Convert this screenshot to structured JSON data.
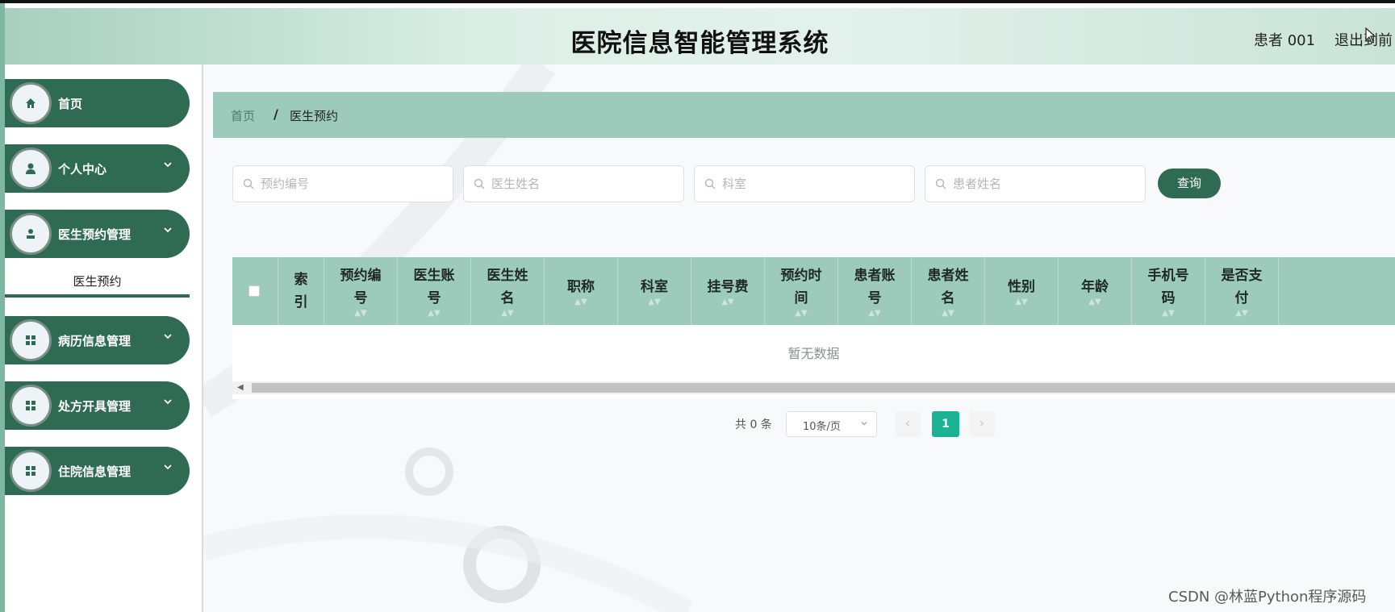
{
  "header": {
    "title": "医院信息智能管理系统",
    "user_label": "患者 001",
    "logout_label": "退出到前"
  },
  "sidebar": {
    "items": [
      {
        "label": "首页",
        "icon": "home-icon"
      },
      {
        "label": "个人中心",
        "icon": "user-icon"
      },
      {
        "label": "医生预约管理",
        "icon": "doctor-icon"
      },
      {
        "label": "病历信息管理",
        "icon": "grid-icon"
      },
      {
        "label": "处方开具管理",
        "icon": "grid-icon"
      },
      {
        "label": "住院信息管理",
        "icon": "grid-icon"
      }
    ],
    "submenu": {
      "label": "医生预约"
    }
  },
  "breadcrumb": {
    "home": "首页",
    "separator": "/",
    "current": "医生预约"
  },
  "search": {
    "fields": [
      {
        "placeholder": "预约编号"
      },
      {
        "placeholder": "医生姓名"
      },
      {
        "placeholder": "科室"
      },
      {
        "placeholder": "患者姓名"
      }
    ],
    "button_label": "查询"
  },
  "table": {
    "columns": [
      {
        "label": "索引",
        "sortable": false
      },
      {
        "label": "预约编号",
        "sortable": true
      },
      {
        "label": "医生账号",
        "sortable": true
      },
      {
        "label": "医生姓名",
        "sortable": true
      },
      {
        "label": "职称",
        "sortable": true
      },
      {
        "label": "科室",
        "sortable": true
      },
      {
        "label": "挂号费",
        "sortable": true
      },
      {
        "label": "预约时间",
        "sortable": true
      },
      {
        "label": "患者账号",
        "sortable": true
      },
      {
        "label": "患者姓名",
        "sortable": true
      },
      {
        "label": "性别",
        "sortable": true
      },
      {
        "label": "年龄",
        "sortable": true
      },
      {
        "label": "手机号码",
        "sortable": true
      },
      {
        "label": "是否支付",
        "sortable": true
      }
    ],
    "empty_text": "暂无数据"
  },
  "pagination": {
    "total": "共 0 条",
    "page_size": "10条/页",
    "current_page": "1",
    "prev": "‹",
    "next": "›"
  },
  "watermark": "CSDN @林蓝Python程序源码",
  "colors": {
    "primary": "#2f6a52",
    "header_teal": "#9ccbbb",
    "active_page": "#1ab394"
  }
}
